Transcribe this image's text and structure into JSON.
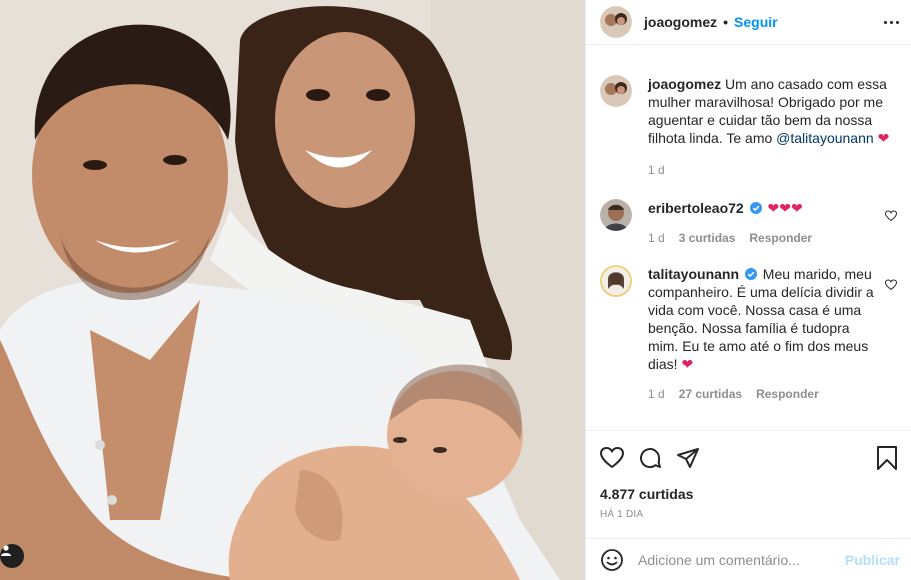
{
  "post": {
    "username": "joaogomez",
    "separator": "•",
    "follow_label": "Seguir"
  },
  "caption": {
    "username": "joaogomez",
    "text": "Um ano casado com essa mulher maravilhosa! Obrigado por me aguentar e cuidar tão bem da nossa filhota linda. Te amo",
    "mention": "@talitayounann",
    "emoji": "❤",
    "time": "1 d"
  },
  "comments": [
    {
      "username": "eribertoleao72",
      "text": "❤❤❤",
      "time": "1 d",
      "likes": "3 curtidas",
      "reply": "Responder"
    },
    {
      "username": "talitayounann",
      "text": "Meu marido, meu companheiro. É uma delícia dividir a vida com você. Nossa casa é uma benção. Nossa família é tudopra mim. Eu te amo até o fim dos meus dias!",
      "emoji": "❤",
      "time": "1 d",
      "likes": "27 curtidas",
      "reply": "Responder"
    }
  ],
  "footer": {
    "likes": "4.877 curtidas",
    "posted": "HÁ 1 DIA",
    "comment_placeholder": "Adicione um comentário...",
    "publish_label": "Publicar"
  },
  "colors": {
    "accent": "#0095f6",
    "heart": "#e0245e",
    "publish_disabled": "#b2dffc",
    "muted": "#8e8e8e"
  }
}
